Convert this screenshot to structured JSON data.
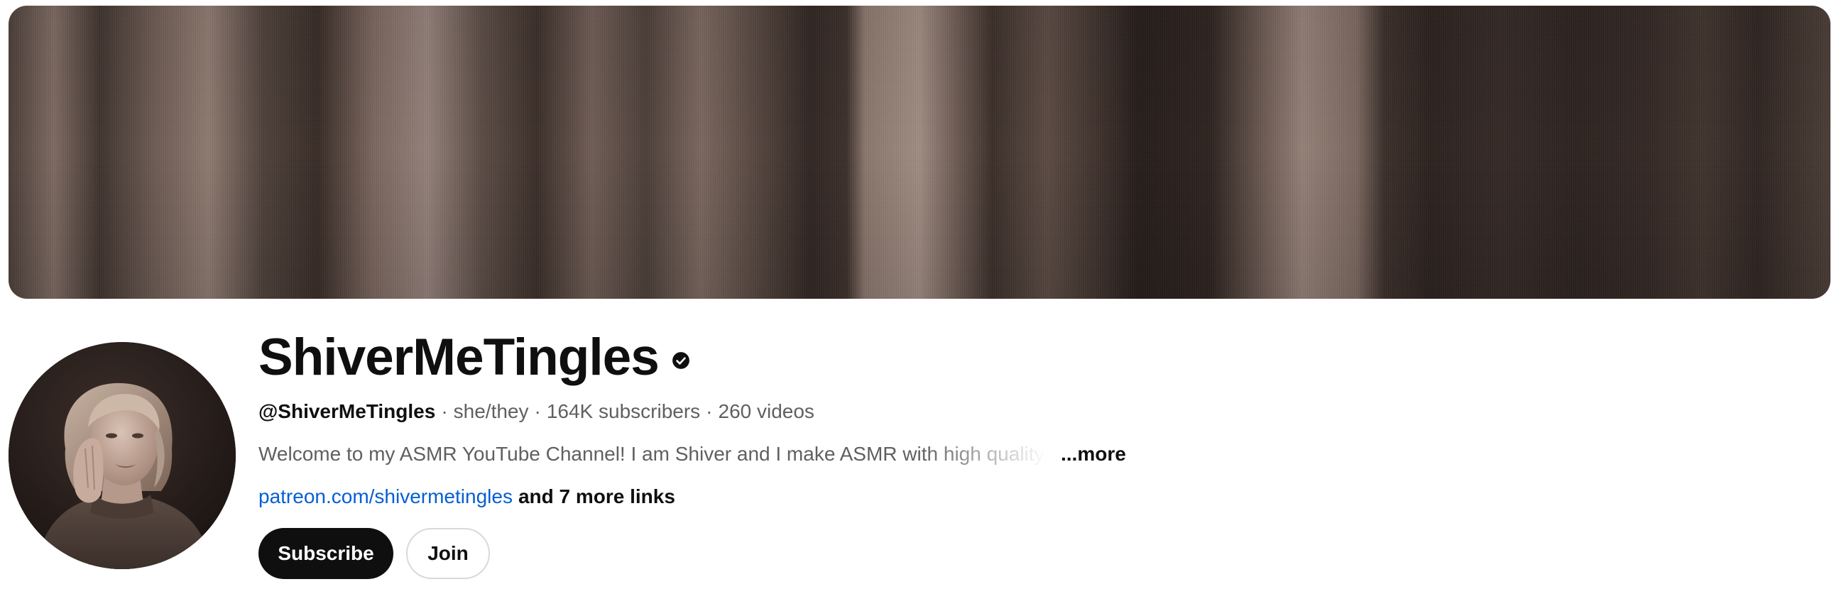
{
  "channel": {
    "title": "ShiverMeTingles",
    "verified_icon": "verified-check-icon",
    "handle": "@ShiverMeTingles",
    "pronouns": "she/they",
    "subscribers": "164K subscribers",
    "videos": "260 videos",
    "separator": "·",
    "description": "Welcome to my ASMR YouTube Channel! I am Shiver and I make ASMR with high quality,",
    "more_label": "...more",
    "primary_link": "patreon.com/shivermetingles",
    "more_links_label": "and 7 more links"
  },
  "buttons": {
    "subscribe": "Subscribe",
    "join": "Join"
  },
  "colors": {
    "title": "#0f0f0f",
    "meta_text": "#606060",
    "link": "#065fd4",
    "subscribe_bg": "#0f0f0f",
    "subscribe_text": "#ffffff",
    "join_border": "#d9d9d9"
  }
}
